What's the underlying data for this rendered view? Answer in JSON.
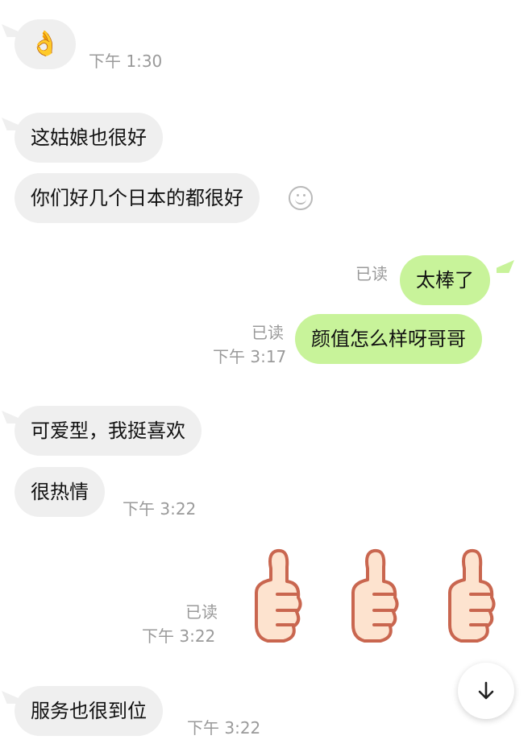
{
  "messages": {
    "m1": {
      "emoji": "👌",
      "time": "下午 1:30"
    },
    "m2": {
      "text": "这姑娘也很好"
    },
    "m3": {
      "text": "你们好几个日本的都很好"
    },
    "m4": {
      "text": "太棒了",
      "read": "已读"
    },
    "m5": {
      "text": "颜值怎么样呀哥哥",
      "read": "已读",
      "time": "下午 3:17"
    },
    "m6": {
      "text": "可爱型，我挺喜欢"
    },
    "m7": {
      "text": "很热情",
      "time": "下午 3:22"
    },
    "m8": {
      "read": "已读",
      "time": "下午 3:22",
      "stickers": [
        "thumbs-up",
        "thumbs-up",
        "thumbs-up"
      ]
    },
    "m9": {
      "text": "服务也很到位",
      "time": "下午 3:22"
    }
  },
  "icons": {
    "react": "smiley-face-icon",
    "scroll": "arrow-down-icon"
  },
  "colors": {
    "incoming_bubble": "#efefef",
    "outgoing_bubble": "#c8f39a",
    "meta_text": "#9a9a9a",
    "thumb_fill": "#fde3cf",
    "thumb_stroke": "#c9664f"
  }
}
